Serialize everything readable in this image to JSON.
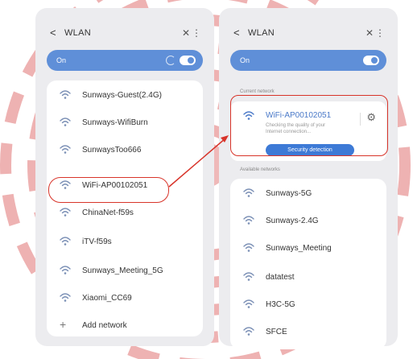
{
  "colors": {
    "accent": "#5f8fd8",
    "button": "#3d7ad6",
    "highlight": "#d8342a",
    "watermark": "#e07373"
  },
  "left_screen": {
    "title": "WLAN",
    "on_label": "On",
    "networks": [
      {
        "name": "Sunways-Guest(2.4G)",
        "icon": "wifi-icon"
      },
      {
        "name": "Sunways-WifiBurn",
        "icon": "wifi-icon"
      },
      {
        "name": "SunwaysToo666",
        "icon": "wifi-icon"
      },
      {
        "name": "WiFi-AP00102051",
        "icon": "wifi-icon"
      },
      {
        "name": "ChinaNet-f59s",
        "icon": "wifi-icon"
      },
      {
        "name": "iTV-f59s",
        "icon": "wifi-icon"
      },
      {
        "name": "Sunways_Meeting_5G",
        "icon": "wifi-icon"
      },
      {
        "name": "Xiaomi_CC69",
        "icon": "wifi-icon"
      }
    ],
    "add_network": "Add network"
  },
  "right_screen": {
    "title": "WLAN",
    "on_label": "On",
    "current_label": "Current network",
    "current": {
      "name": "WiFi-AP00102051",
      "status": "Checking the quality of your Internet connection...",
      "button": "Security detection"
    },
    "available_label": "Available networks",
    "networks": [
      {
        "name": "Sunways-5G",
        "icon": "wifi-icon"
      },
      {
        "name": "Sunways-2.4G",
        "icon": "wifi-icon"
      },
      {
        "name": "Sunways_Meeting",
        "icon": "wifi-icon"
      },
      {
        "name": "datatest",
        "icon": "wifi-icon"
      },
      {
        "name": "H3C-5G",
        "icon": "wifi-icon"
      },
      {
        "name": "SFCE",
        "icon": "wifi-icon"
      }
    ]
  }
}
